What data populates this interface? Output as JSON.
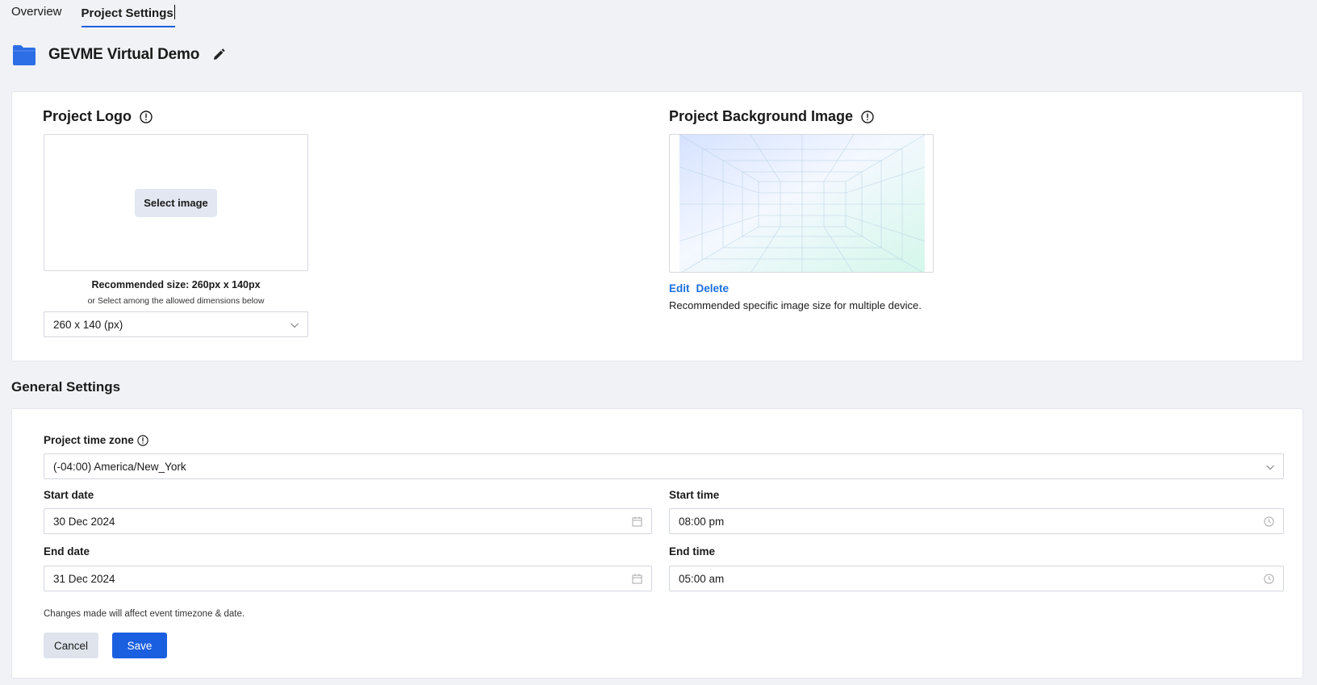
{
  "tabs": [
    {
      "label": "Overview",
      "active": false
    },
    {
      "label": "Project Settings",
      "active": true
    }
  ],
  "project": {
    "name": "GEVME Virtual Demo",
    "folder_icon": "folder-icon",
    "edit_icon": "pencil-icon",
    "accent_color": "#2d6ee6"
  },
  "logo_section": {
    "title": "Project Logo",
    "select_button": "Select image",
    "recommended_size": "Recommended size: 260px x 140px",
    "dimension_hint": "or Select among the allowed dimensions below",
    "dimension_selected": "260 x 140 (px)"
  },
  "background_section": {
    "title": "Project Background Image",
    "edit_label": "Edit",
    "delete_label": "Delete",
    "note": "Recommended specific image size for multiple device."
  },
  "general": {
    "heading": "General Settings",
    "timezone_label": "Project time zone",
    "timezone_value": "(-04:00) America/New_York",
    "start_date_label": "Start date",
    "start_date_value": "30 Dec 2024",
    "start_time_label": "Start time",
    "start_time_value": "08:00 pm",
    "end_date_label": "End date",
    "end_date_value": "31 Dec 2024",
    "end_time_label": "End time",
    "end_time_value": "05:00 am",
    "note": "Changes made will affect event timezone & date.",
    "cancel_label": "Cancel",
    "save_label": "Save"
  },
  "colors": {
    "primary": "#1a5fe0",
    "link": "#1a6fe0",
    "background": "#f1f2f6"
  }
}
